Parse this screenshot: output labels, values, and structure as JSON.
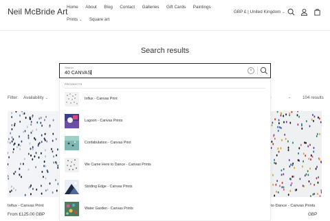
{
  "header": {
    "brand": "Neil McBride Art",
    "nav": [
      "Home",
      "About",
      "Blog",
      "Contact",
      "Galleries",
      "Gift Cards",
      "Paintings"
    ],
    "nav_row2": [
      "Prints",
      "Square art"
    ],
    "locale": "GBP £ | United Kingdom"
  },
  "page_title": "Search results",
  "search": {
    "label": "Search",
    "value": "40 CANVAS"
  },
  "dropdown": {
    "heading": "PRODUCTS",
    "items": [
      "Influx - Canvas Print",
      "Lagoon - Canvas Prints",
      "Confabulation - Canvas Print",
      "We Came Here to Dance - Canvas Prints",
      "Striding Edge - Canvas Prints",
      "Water Garden - Canvas Prints"
    ]
  },
  "filters": {
    "label": "Filter:",
    "availability": "Availability",
    "sort_value": "ce",
    "results_count": "104 results"
  },
  "products": [
    {
      "title": "Influx - Canvas Print",
      "price": "From £125.00 GBP"
    },
    {
      "title": "to Dance - Canvas Prints",
      "price": "GBP"
    }
  ]
}
